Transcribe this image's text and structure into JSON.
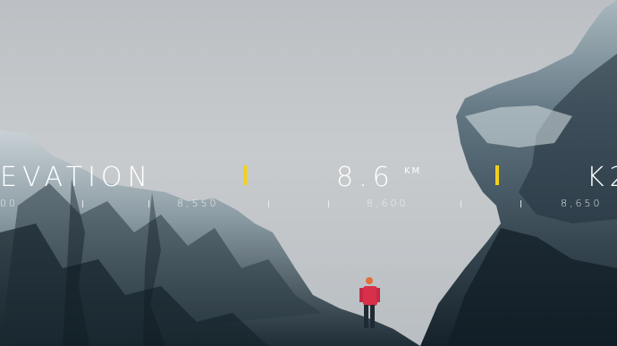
{
  "hud": {
    "left_label": "EVATION",
    "center_value": "8.6",
    "center_unit": "KM",
    "right_label": "K2"
  },
  "scale": {
    "left_partial": "00",
    "ticks": [
      "8,550",
      "8,600",
      "8,650"
    ]
  },
  "colors": {
    "accent": "#f2d11b",
    "text": "#ffffff",
    "sky": "#c4c8cc"
  }
}
